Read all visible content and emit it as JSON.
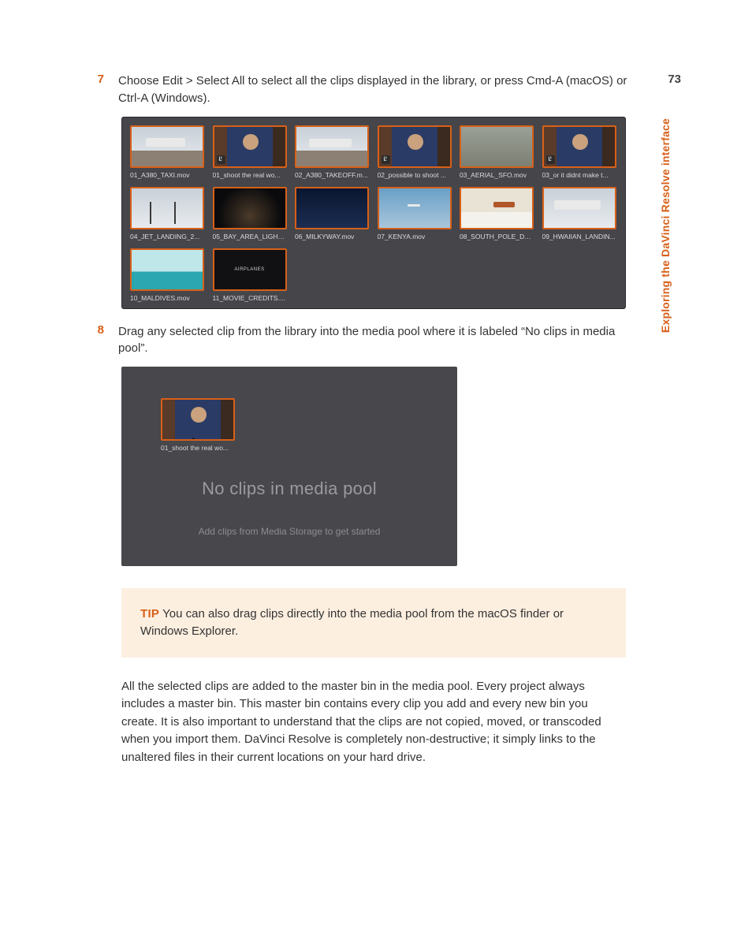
{
  "page_number": "73",
  "side_title": "Exploring the DaVinci Resolve interface",
  "step7": {
    "num": "7",
    "text": "Choose Edit > Select All to select all the clips displayed in the library, or press Cmd-A (macOS) or Ctrl-A (Windows)."
  },
  "step8": {
    "num": "8",
    "text": "Drag any selected clip from the library into the media pool where it is labeled “No clips in media pool”."
  },
  "library": {
    "clips": [
      {
        "label": "01_A380_TAXI.mov",
        "audio": false
      },
      {
        "label": "01_shoot the real wo...",
        "audio": true
      },
      {
        "label": "02_A380_TAKEOFF.m...",
        "audio": false
      },
      {
        "label": "02_possible to shoot ...",
        "audio": true
      },
      {
        "label": "03_AERIAL_SFO.mov",
        "audio": false
      },
      {
        "label": "03_or it didnt make t...",
        "audio": true
      },
      {
        "label": "04_JET_LANDING_2...",
        "audio": false
      },
      {
        "label": "05_BAY_AREA_LIGHT...",
        "audio": false
      },
      {
        "label": "06_MILKYWAY.mov",
        "audio": false
      },
      {
        "label": "07_KENYA.mov",
        "audio": false
      },
      {
        "label": "08_SOUTH_POLE_DC...",
        "audio": false
      },
      {
        "label": "09_HWAIIAN_LANDIN...",
        "audio": false
      },
      {
        "label": "10_MALDIVES.mov",
        "audio": false
      },
      {
        "label": "11_MOVIE_CREDITS....",
        "audio": false
      }
    ],
    "credits_text": "AIRPLANES"
  },
  "pool": {
    "dragged_clip_label": "01_shoot the real wo...",
    "message": "No clips in media pool",
    "sub": "Add clips from Media Storage to get started"
  },
  "tip": {
    "label": "TIP",
    "text": "You can also drag clips directly into the media pool from the macOS finder or Windows Explorer."
  },
  "para": "All the selected clips are added to the master bin in the media pool. Every project always includes a master bin. This master bin contains every clip you add and every new bin you create. It is also important to understand that the clips are not copied, moved, or transcoded when you import them. DaVinci Resolve is completely non-destructive; it simply links to the unaltered files in their current locations on your hard drive."
}
